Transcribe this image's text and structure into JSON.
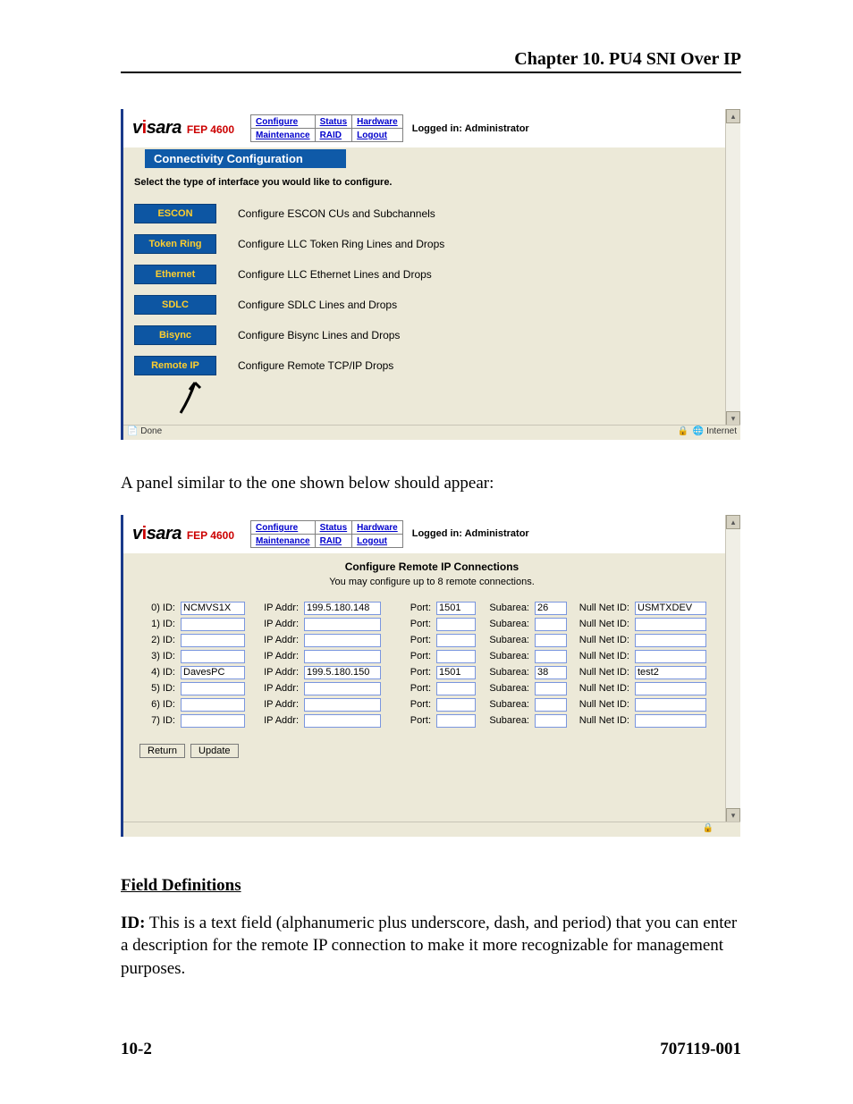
{
  "header": {
    "chapter": "Chapter 10. PU4 SNI Over IP"
  },
  "brand": {
    "name_pre": "v",
    "name_i": "i",
    "name_post": "sara",
    "model": "FEP 4600"
  },
  "nav": {
    "configure": "Configure",
    "status": "Status",
    "hardware": "Hardware",
    "maintenance": "Maintenance",
    "raid": "RAID",
    "logout": "Logout"
  },
  "logged_in": "Logged in: Administrator",
  "shot1": {
    "title": "Connectivity Configuration",
    "subtitle": "Select the type of interface you would like to configure.",
    "rows": [
      {
        "btn": "ESCON",
        "desc": "Configure ESCON CUs and Subchannels"
      },
      {
        "btn": "Token Ring",
        "desc": "Configure LLC Token Ring Lines and Drops"
      },
      {
        "btn": "Ethernet",
        "desc": "Configure LLC Ethernet Lines and Drops"
      },
      {
        "btn": "SDLC",
        "desc": "Configure SDLC Lines and Drops"
      },
      {
        "btn": "Bisync",
        "desc": "Configure Bisync Lines and Drops"
      },
      {
        "btn": "Remote IP",
        "desc": "Configure Remote TCP/IP Drops"
      }
    ],
    "status_done": "Done",
    "status_inet": "Internet"
  },
  "mid_text": "A panel similar to the one shown below should appear:",
  "shot2": {
    "title": "Configure Remote IP Connections",
    "subtitle": "You may configure up to 8 remote connections.",
    "labels": {
      "id": "ID:",
      "ip": "IP Addr:",
      "port": "Port:",
      "sub": "Subarea:",
      "null": "Null Net ID:"
    },
    "rows": [
      {
        "n": "0)",
        "id": "NCMVS1X",
        "ip": "199.5.180.148",
        "port": "1501",
        "sub": "26",
        "null": "USMTXDEV"
      },
      {
        "n": "1)",
        "id": "",
        "ip": "",
        "port": "",
        "sub": "",
        "null": ""
      },
      {
        "n": "2)",
        "id": "",
        "ip": "",
        "port": "",
        "sub": "",
        "null": ""
      },
      {
        "n": "3)",
        "id": "",
        "ip": "",
        "port": "",
        "sub": "",
        "null": ""
      },
      {
        "n": "4)",
        "id": "DavesPC",
        "ip": "199.5.180.150",
        "port": "1501",
        "sub": "38",
        "null": "test2"
      },
      {
        "n": "5)",
        "id": "",
        "ip": "",
        "port": "",
        "sub": "",
        "null": ""
      },
      {
        "n": "6)",
        "id": "",
        "ip": "",
        "port": "",
        "sub": "",
        "null": ""
      },
      {
        "n": "7)",
        "id": "",
        "ip": "",
        "port": "",
        "sub": "",
        "null": ""
      }
    ],
    "buttons": {
      "return": "Return",
      "update": "Update"
    }
  },
  "fielddef": {
    "heading": "Field Definitions",
    "id_label": "ID:",
    "id_text": "  This is a text field (alphanumeric plus underscore, dash, and period) that you can enter a description for the remote IP connection to make it more recognizable for management purposes."
  },
  "footer": {
    "left": "10-2",
    "right": "707119-001"
  }
}
